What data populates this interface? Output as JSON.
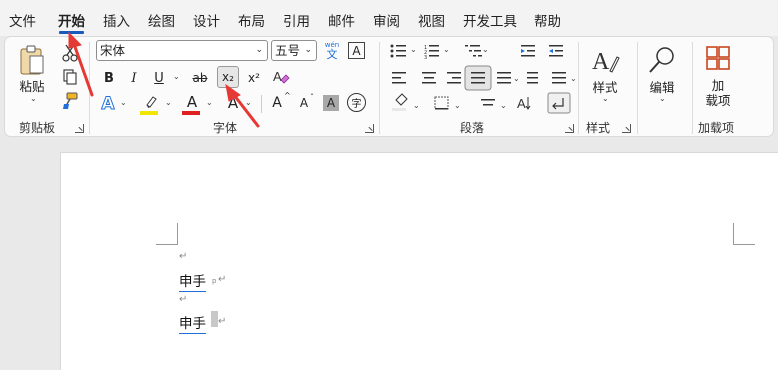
{
  "menu": {
    "items": [
      "文件",
      "开始",
      "插入",
      "绘图",
      "设计",
      "布局",
      "引用",
      "邮件",
      "审阅",
      "视图",
      "开发工具",
      "帮助"
    ],
    "active": "开始"
  },
  "clipboard": {
    "paste_label": "粘贴",
    "group_label": "剪贴板"
  },
  "font": {
    "font_name": "宋体",
    "font_size": "五号",
    "phonetic_top": "wén",
    "phonetic_bottom": "文",
    "char_border": "A",
    "bold": "B",
    "italic": "I",
    "underline": "U",
    "strike": "ab",
    "subscript": "x₂",
    "superscript": "x²",
    "text_effect": "A",
    "font_color": "A",
    "char_scale": "A",
    "grow": "A",
    "shrink": "A",
    "char_shade": "A",
    "enclose": "字",
    "group_label": "字体",
    "font_color_bar": "#e02020",
    "highlight_bar": "#f2e600"
  },
  "paragraph": {
    "group_label": "段落"
  },
  "styles": {
    "label": "样式",
    "group_label": "样式"
  },
  "editing": {
    "label": "编辑"
  },
  "addins": {
    "label_line1": "加",
    "label_line2": "载项",
    "group_label": "加载项"
  },
  "document": {
    "line1": "申手",
    "line2": "申手",
    "para_mark": "↵",
    "small_mark": "p"
  },
  "colors": {
    "accent": "#185abd",
    "arrow": "#e53935"
  }
}
